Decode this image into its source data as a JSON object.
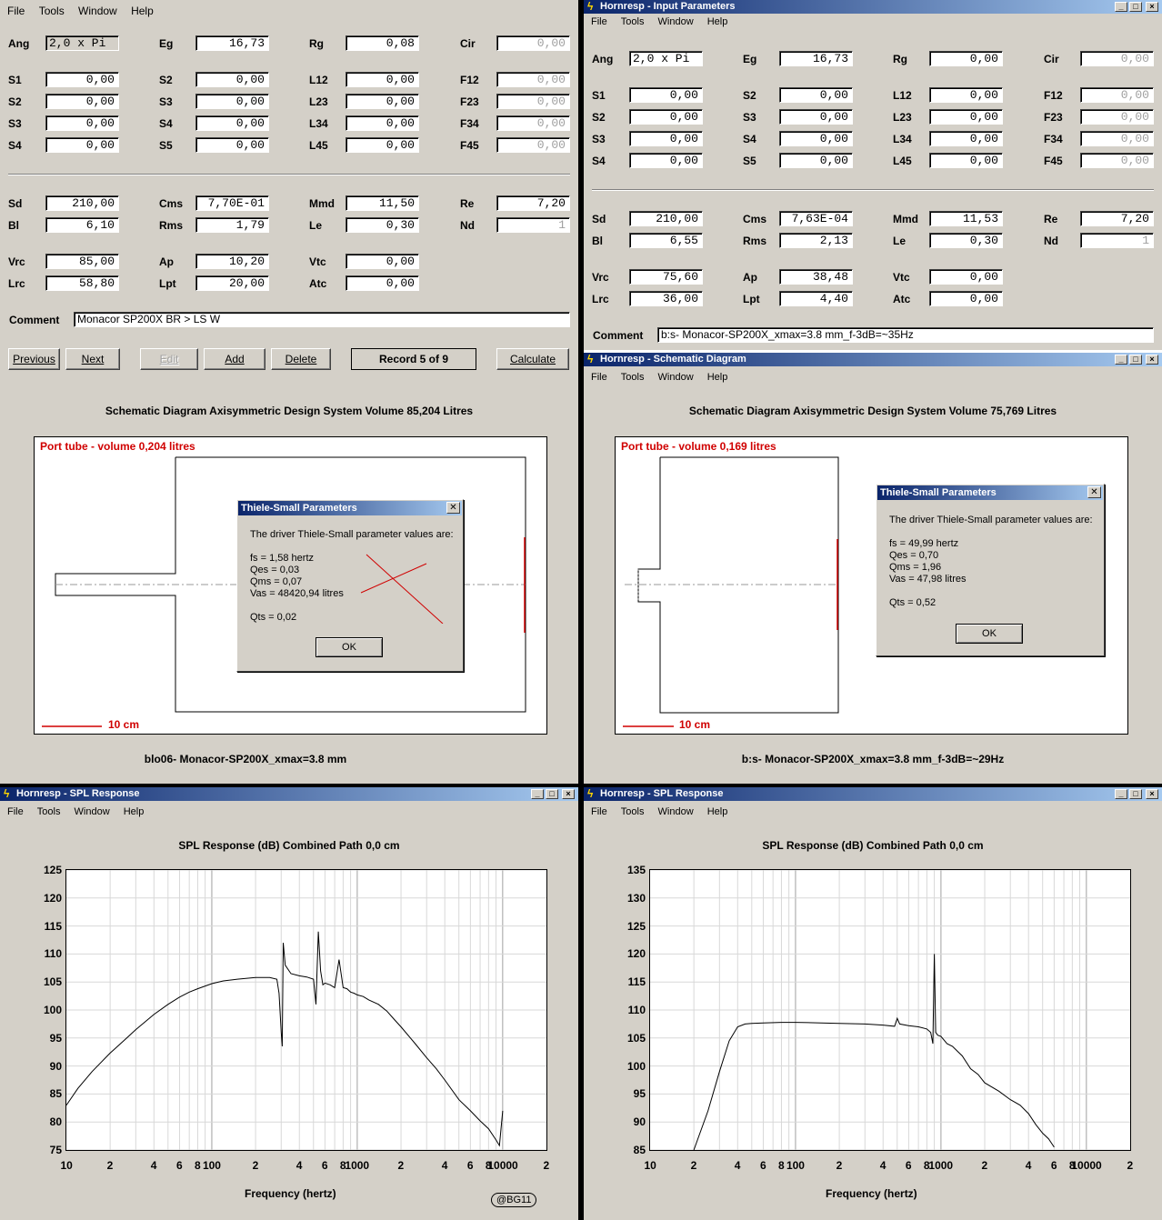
{
  "left_input": {
    "menu": [
      "File",
      "Tools",
      "Window",
      "Help"
    ],
    "fields": {
      "ang": {
        "label": "Ang",
        "value": "2,0 x Pi"
      },
      "eg": {
        "label": "Eg",
        "value": "16,73"
      },
      "rg": {
        "label": "Rg",
        "value": "0,08"
      },
      "cir": {
        "label": "Cir",
        "value": "0,00"
      },
      "s1": {
        "label": "S1",
        "value": "0,00"
      },
      "s2b": {
        "label": "S2",
        "value": "0,00"
      },
      "l12": {
        "label": "L12",
        "value": "0,00"
      },
      "f12": {
        "label": "F12",
        "value": "0,00"
      },
      "s2": {
        "label": "S2",
        "value": "0,00"
      },
      "s3b": {
        "label": "S3",
        "value": "0,00"
      },
      "l23": {
        "label": "L23",
        "value": "0,00"
      },
      "f23": {
        "label": "F23",
        "value": "0,00"
      },
      "s3": {
        "label": "S3",
        "value": "0,00"
      },
      "s4b": {
        "label": "S4",
        "value": "0,00"
      },
      "l34": {
        "label": "L34",
        "value": "0,00"
      },
      "f34": {
        "label": "F34",
        "value": "0,00"
      },
      "s4": {
        "label": "S4",
        "value": "0,00"
      },
      "s5b": {
        "label": "S5",
        "value": "0,00"
      },
      "l45": {
        "label": "L45",
        "value": "0,00"
      },
      "f45": {
        "label": "F45",
        "value": "0,00"
      },
      "sd": {
        "label": "Sd",
        "value": "210,00"
      },
      "cms": {
        "label": "Cms",
        "value": "7,70E-01"
      },
      "mmd": {
        "label": "Mmd",
        "value": "11,50"
      },
      "re": {
        "label": "Re",
        "value": "7,20"
      },
      "bl": {
        "label": "Bl",
        "value": "6,10"
      },
      "rms": {
        "label": "Rms",
        "value": "1,79"
      },
      "le": {
        "label": "Le",
        "value": "0,30"
      },
      "nd": {
        "label": "Nd",
        "value": "1"
      },
      "vrc": {
        "label": "Vrc",
        "value": "85,00"
      },
      "ap": {
        "label": "Ap",
        "value": "10,20"
      },
      "vtc": {
        "label": "Vtc",
        "value": "0,00"
      },
      "lrc": {
        "label": "Lrc",
        "value": "58,80"
      },
      "lpt": {
        "label": "Lpt",
        "value": "20,00"
      },
      "atc": {
        "label": "Atc",
        "value": "0,00"
      }
    },
    "comment_label": "Comment",
    "comment": "Monacor SP200X BR > LS W",
    "buttons": {
      "previous": "Previous",
      "next": "Next",
      "edit": "Edit",
      "add": "Add",
      "delete": "Delete",
      "record": "Record 5 of 9",
      "calculate": "Calculate"
    }
  },
  "right_input": {
    "title": "Hornresp - Input Parameters",
    "menu": [
      "File",
      "Tools",
      "Window",
      "Help"
    ],
    "fields": {
      "ang": {
        "label": "Ang",
        "value": "2,0 x Pi"
      },
      "eg": {
        "label": "Eg",
        "value": "16,73"
      },
      "rg": {
        "label": "Rg",
        "value": "0,00"
      },
      "cir": {
        "label": "Cir",
        "value": "0,00"
      },
      "s1": {
        "label": "S1",
        "value": "0,00"
      },
      "s2b": {
        "label": "S2",
        "value": "0,00"
      },
      "l12": {
        "label": "L12",
        "value": "0,00"
      },
      "f12": {
        "label": "F12",
        "value": "0,00"
      },
      "s2": {
        "label": "S2",
        "value": "0,00"
      },
      "s3b": {
        "label": "S3",
        "value": "0,00"
      },
      "l23": {
        "label": "L23",
        "value": "0,00"
      },
      "f23": {
        "label": "F23",
        "value": "0,00"
      },
      "s3": {
        "label": "S3",
        "value": "0,00"
      },
      "s4b": {
        "label": "S4",
        "value": "0,00"
      },
      "l34": {
        "label": "L34",
        "value": "0,00"
      },
      "f34": {
        "label": "F34",
        "value": "0,00"
      },
      "s4": {
        "label": "S4",
        "value": "0,00"
      },
      "s5b": {
        "label": "S5",
        "value": "0,00"
      },
      "l45": {
        "label": "L45",
        "value": "0,00"
      },
      "f45": {
        "label": "F45",
        "value": "0,00"
      },
      "sd": {
        "label": "Sd",
        "value": "210,00"
      },
      "cms": {
        "label": "Cms",
        "value": "7,63E-04"
      },
      "mmd": {
        "label": "Mmd",
        "value": "11,53"
      },
      "re": {
        "label": "Re",
        "value": "7,20"
      },
      "bl": {
        "label": "Bl",
        "value": "6,55"
      },
      "rms": {
        "label": "Rms",
        "value": "2,13"
      },
      "le": {
        "label": "Le",
        "value": "0,30"
      },
      "nd": {
        "label": "Nd",
        "value": "1"
      },
      "vrc": {
        "label": "Vrc",
        "value": "75,60"
      },
      "ap": {
        "label": "Ap",
        "value": "38,48"
      },
      "vtc": {
        "label": "Vtc",
        "value": "0,00"
      },
      "lrc": {
        "label": "Lrc",
        "value": "36,00"
      },
      "lpt": {
        "label": "Lpt",
        "value": "4,40"
      },
      "atc": {
        "label": "Atc",
        "value": "0,00"
      }
    },
    "comment_label": "Comment",
    "comment": "b:s- Monacor-SP200X_xmax=3.8 mm_f-3dB=~35Hz"
  },
  "left_schematic": {
    "header": "Schematic Diagram   Axisymmetric Design   System Volume 85,204 Litres",
    "port_label": "Port tube - volume 0,204 litres",
    "scale": "10 cm",
    "footer": "blo06- Monacor-SP200X_xmax=3.8 mm",
    "dialog": {
      "title": "Thiele-Small Parameters",
      "intro": "The driver Thiele-Small parameter values are:",
      "fs": "fs = 1,58 hertz",
      "qes": "Qes = 0,03",
      "qms": "Qms = 0,07",
      "vas": "Vas = 48420,94 litres",
      "qts": "Qts = 0,02",
      "ok": "OK"
    }
  },
  "right_schematic": {
    "title": "Hornresp - Schematic Diagram",
    "menu": [
      "File",
      "Tools",
      "Window",
      "Help"
    ],
    "header": "Schematic Diagram   Axisymmetric Design   System Volume 75,769 Litres",
    "port_label": "Port tube - volume 0,169 litres",
    "scale": "10 cm",
    "footer": "b:s- Monacor-SP200X_xmax=3.8 mm_f-3dB=~29Hz",
    "dialog": {
      "title": "Thiele-Small Parameters",
      "intro": "The driver Thiele-Small parameter values are:",
      "fs": "fs = 49,99 hertz",
      "qes": "Qes = 0,70",
      "qms": "Qms = 1,96",
      "vas": "Vas = 47,98 litres",
      "qts": "Qts = 0,52",
      "ok": "OK"
    }
  },
  "left_spl": {
    "title": "Hornresp - SPL Response",
    "menu": [
      "File",
      "Tools",
      "Window",
      "Help"
    ],
    "header": "SPL Response (dB)   Combined   Path 0,0 cm",
    "xlabel": "Frequency (hertz)",
    "watermark": "@BG11"
  },
  "right_spl": {
    "title": "Hornresp - SPL Response",
    "menu": [
      "File",
      "Tools",
      "Window",
      "Help"
    ],
    "header": "SPL Response (dB)   Combined   Path 0,0 cm",
    "xlabel": "Frequency (hertz)"
  },
  "chart_data": [
    {
      "type": "line",
      "title": "SPL Response (dB)   Combined   Path 0,0 cm",
      "xlabel": "Frequency (hertz)",
      "ylabel": "",
      "xscale": "log",
      "xlim": [
        10,
        20000
      ],
      "ylim": [
        75,
        125
      ],
      "yticks": [
        75,
        80,
        85,
        90,
        95,
        100,
        105,
        110,
        115,
        120,
        125
      ],
      "xtick_labels": [
        "10",
        "2",
        "4",
        "6",
        "8",
        "100",
        "2",
        "4",
        "6",
        "8",
        "1000",
        "2",
        "4",
        "6",
        "8",
        "10000",
        "2"
      ],
      "grid": true,
      "x": [
        10,
        12,
        15,
        20,
        25,
        30,
        40,
        50,
        60,
        70,
        80,
        100,
        120,
        150,
        200,
        250,
        280,
        290,
        300,
        305,
        310,
        320,
        350,
        400,
        450,
        500,
        520,
        540,
        560,
        580,
        600,
        650,
        700,
        750,
        800,
        850,
        900,
        950,
        1000,
        1100,
        1200,
        1400,
        1600,
        1800,
        2000,
        2500,
        3000,
        3500,
        4000,
        5000,
        6000,
        7000,
        8000,
        9000,
        9500,
        10000
      ],
      "values": [
        83,
        86,
        89,
        92.3,
        94.6,
        96.5,
        99.2,
        101,
        102.3,
        103.2,
        103.8,
        104.7,
        105.2,
        105.5,
        105.8,
        105.8,
        105.5,
        103,
        96,
        93.5,
        112,
        108,
        106.5,
        106.1,
        105.9,
        105.5,
        101,
        114,
        107,
        104.5,
        104.8,
        104.5,
        104,
        109,
        104,
        103.8,
        103.2,
        103,
        102.7,
        102.4,
        101.8,
        101,
        99.8,
        98.3,
        97,
        94,
        91.5,
        89.5,
        87.5,
        84,
        82,
        80.2,
        78.8,
        76.8,
        75.8,
        82
      ]
    },
    {
      "type": "line",
      "title": "SPL Response (dB)   Combined   Path 0,0 cm",
      "xlabel": "Frequency (hertz)",
      "ylabel": "",
      "xscale": "log",
      "xlim": [
        10,
        20000
      ],
      "ylim": [
        85,
        135
      ],
      "yticks": [
        85,
        90,
        95,
        100,
        105,
        110,
        115,
        120,
        125,
        130,
        135
      ],
      "xtick_labels": [
        "10",
        "2",
        "4",
        "6",
        "8",
        "100",
        "2",
        "4",
        "6",
        "8",
        "1000",
        "2",
        "4",
        "6",
        "8",
        "10000",
        "2"
      ],
      "grid": true,
      "x": [
        20,
        25,
        30,
        35,
        40,
        45,
        50,
        60,
        80,
        100,
        150,
        200,
        300,
        400,
        480,
        500,
        520,
        600,
        700,
        800,
        850,
        880,
        900,
        920,
        950,
        1000,
        1100,
        1200,
        1400,
        1600,
        1800,
        2000,
        2500,
        3000,
        3500,
        4000,
        4500,
        5000,
        5500,
        6000
      ],
      "values": [
        85,
        92,
        99,
        104.5,
        107,
        107.5,
        107.6,
        107.7,
        107.8,
        107.8,
        107.7,
        107.6,
        107.5,
        107.3,
        107.1,
        108.5,
        107.5,
        107.2,
        107,
        106.6,
        106,
        104,
        120,
        106,
        105.5,
        105.3,
        104,
        103.5,
        101.8,
        99.5,
        98.5,
        97,
        95.5,
        94,
        93,
        91.5,
        89.5,
        88,
        87,
        85.5
      ]
    }
  ]
}
